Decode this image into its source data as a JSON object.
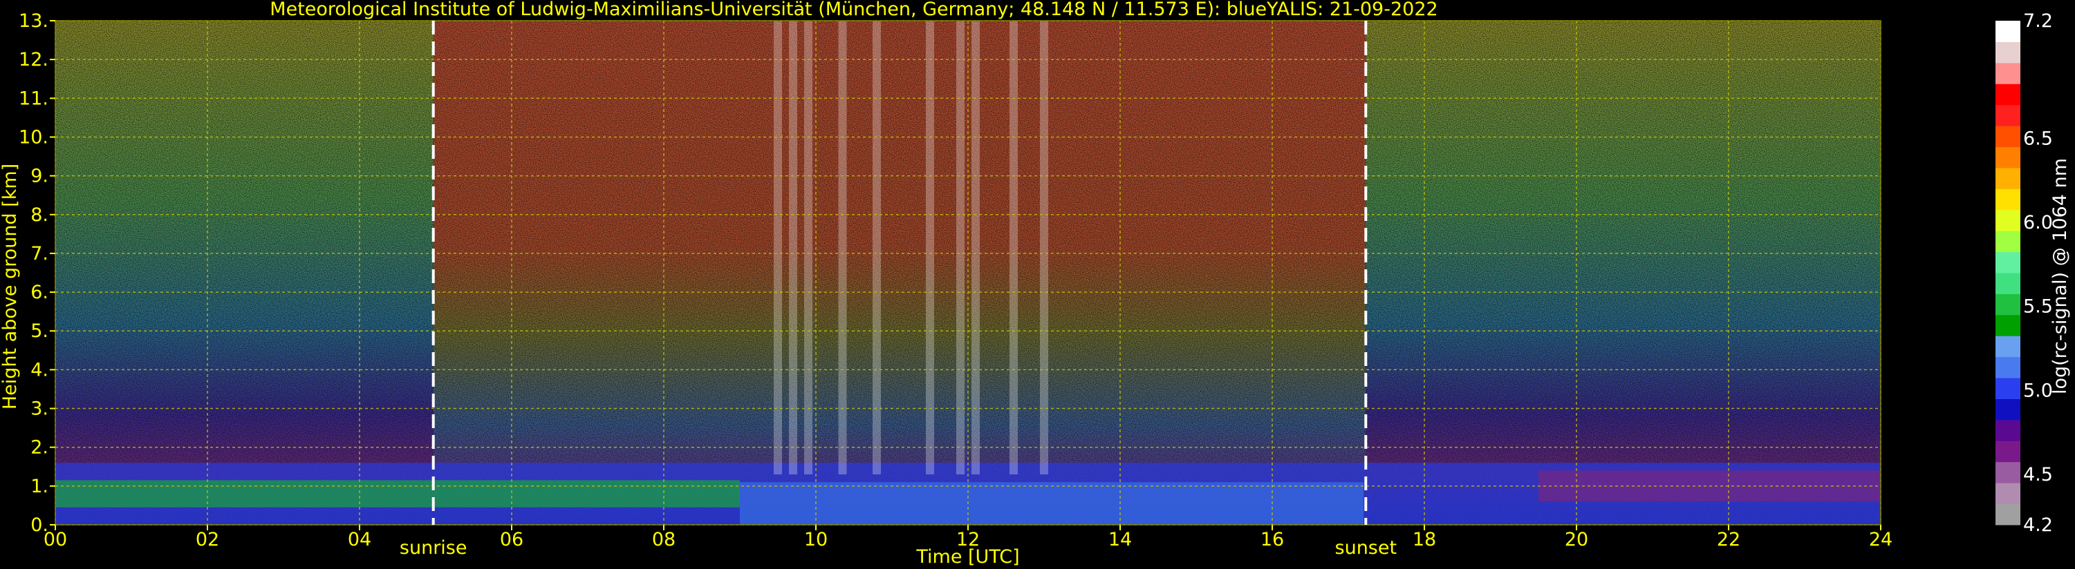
{
  "chart_data": {
    "type": "heatmap",
    "title": "Meteorological Institute of Ludwig-Maximilians-Universität (München, Germany; 48.148 N / 11.573 E):     blueYALIS: 21-09-2022",
    "xlabel": "Time [UTC]",
    "ylabel": "Height above ground [km]",
    "xlim": [
      0,
      24
    ],
    "ylim": [
      0,
      13
    ],
    "x_ticks": [
      "00",
      "02",
      "04",
      "06",
      "08",
      "10",
      "12",
      "14",
      "16",
      "18",
      "20",
      "22",
      "24"
    ],
    "y_ticks": [
      "0.",
      "1.",
      "2.",
      "3.",
      "4.",
      "5.",
      "6.",
      "7.",
      "8.",
      "9.",
      "10.",
      "11.",
      "12.",
      "13."
    ],
    "grid": true,
    "markers": [
      {
        "label": "sunrise",
        "x": 4.97
      },
      {
        "label": "sunset",
        "x": 17.23
      }
    ],
    "colorbar": {
      "label": "log(rc-signal) @ 1064 nm",
      "ticks": [
        "4.2",
        "4.5",
        "5.0",
        "5.5",
        "6.0",
        "6.5",
        "7.2"
      ],
      "tick_values": [
        4.2,
        4.5,
        5.0,
        5.5,
        6.0,
        6.5,
        7.2
      ],
      "range": [
        4.2,
        7.2
      ],
      "colors": [
        "#a0a0a0",
        "#b08cb0",
        "#9a5ca0",
        "#7a1a8a",
        "#5a0a90",
        "#1010c0",
        "#2a40f0",
        "#4a7af0",
        "#6aa0f0",
        "#00a000",
        "#20c040",
        "#40e080",
        "#60f0a0",
        "#a0ff40",
        "#e0ff20",
        "#ffe000",
        "#ffb000",
        "#ff8000",
        "#ff5000",
        "#ff2020",
        "#ff0000",
        "#ff9090",
        "#e8d0d0",
        "#ffffff"
      ]
    }
  },
  "colors": {
    "background": "#000000",
    "text": "#ffff00",
    "grid": "#c8c800",
    "marker": "#ffffff"
  }
}
